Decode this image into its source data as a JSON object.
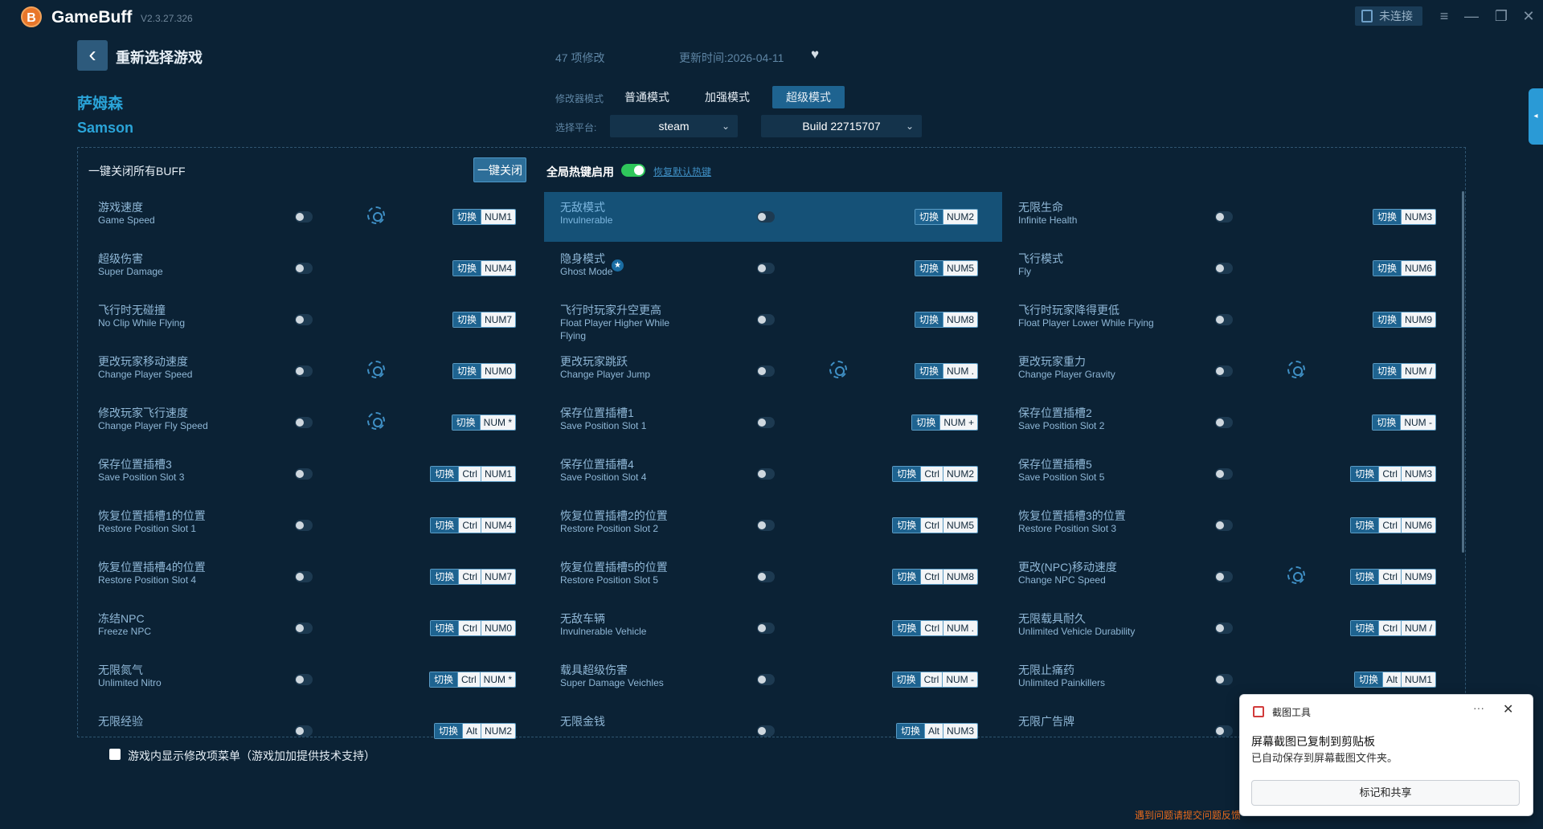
{
  "app": {
    "name": "GameBuff",
    "version": "V2.3.27.326",
    "logo_letter": "B",
    "status": "未连接"
  },
  "header": {
    "back_label": "重新选择游戏",
    "count_text": "47 项修改",
    "update_text": "更新时间:2026-04-11"
  },
  "game": {
    "name_cn": "萨姆森",
    "name_en": "Samson"
  },
  "modes": {
    "label": "修改器模式",
    "items": [
      "普通模式",
      "加强模式",
      "超级模式"
    ],
    "active": "超级模式"
  },
  "platform": {
    "label": "选择平台:",
    "selected": "steam",
    "build": "Build 22715707"
  },
  "toolbar": {
    "close_all_label": "一键关闭所有BUFF",
    "close_btn": "一键关闭",
    "hotkey_label": "全局热键启用",
    "hotkey_enabled": true,
    "restore_link": "恢复默认热键"
  },
  "switch_label": "切换",
  "cheats": [
    {
      "cn": "游戏速度",
      "en": "Game Speed",
      "keys": [
        "NUM1"
      ],
      "gear": true
    },
    {
      "cn": "无敌模式",
      "en": "Invulnerable",
      "keys": [
        "NUM2"
      ],
      "highlight": true
    },
    {
      "cn": "无限生命",
      "en": "Infinite Health",
      "keys": [
        "NUM3"
      ]
    },
    {
      "cn": "超级伤害",
      "en": "Super Damage",
      "keys": [
        "NUM4"
      ]
    },
    {
      "cn": "隐身模式",
      "en": "Ghost Mode",
      "keys": [
        "NUM5"
      ],
      "star": true
    },
    {
      "cn": "飞行模式",
      "en": "Fly",
      "keys": [
        "NUM6"
      ]
    },
    {
      "cn": "飞行时无碰撞",
      "en": "No Clip While Flying",
      "keys": [
        "NUM7"
      ]
    },
    {
      "cn": "飞行时玩家升空更高",
      "en": "Float Player Higher While Flying",
      "keys": [
        "NUM8"
      ]
    },
    {
      "cn": "飞行时玩家降得更低",
      "en": "Float Player Lower While Flying",
      "keys": [
        "NUM9"
      ]
    },
    {
      "cn": "更改玩家移动速度",
      "en": "Change Player Speed",
      "keys": [
        "NUM0"
      ],
      "gear": true
    },
    {
      "cn": "更改玩家跳跃",
      "en": "Change Player Jump",
      "keys": [
        "NUM ."
      ],
      "gear": true
    },
    {
      "cn": "更改玩家重力",
      "en": "Change Player Gravity",
      "keys": [
        "NUM /"
      ],
      "gear": true
    },
    {
      "cn": "修改玩家飞行速度",
      "en": "Change Player Fly Speed",
      "keys": [
        "NUM *"
      ],
      "gear": true
    },
    {
      "cn": "保存位置插槽1",
      "en": "Save Position Slot 1",
      "keys": [
        "NUM +"
      ]
    },
    {
      "cn": "保存位置插槽2",
      "en": "Save Position Slot 2",
      "keys": [
        "NUM -"
      ]
    },
    {
      "cn": "保存位置插槽3",
      "en": "Save Position Slot 3",
      "keys": [
        "Ctrl",
        "NUM1"
      ]
    },
    {
      "cn": "保存位置插槽4",
      "en": "Save Position Slot 4",
      "keys": [
        "Ctrl",
        "NUM2"
      ]
    },
    {
      "cn": "保存位置插槽5",
      "en": "Save Position Slot 5",
      "keys": [
        "Ctrl",
        "NUM3"
      ]
    },
    {
      "cn": "恢复位置插槽1的位置",
      "en": "Restore Position Slot 1",
      "keys": [
        "Ctrl",
        "NUM4"
      ]
    },
    {
      "cn": "恢复位置插槽2的位置",
      "en": "Restore Position Slot 2",
      "keys": [
        "Ctrl",
        "NUM5"
      ]
    },
    {
      "cn": "恢复位置插槽3的位置",
      "en": "Restore Position Slot 3",
      "keys": [
        "Ctrl",
        "NUM6"
      ]
    },
    {
      "cn": "恢复位置插槽4的位置",
      "en": "Restore Position Slot 4",
      "keys": [
        "Ctrl",
        "NUM7"
      ]
    },
    {
      "cn": "恢复位置插槽5的位置",
      "en": "Restore Position Slot 5",
      "keys": [
        "Ctrl",
        "NUM8"
      ]
    },
    {
      "cn": "更改(NPC)移动速度",
      "en": "Change NPC Speed",
      "keys": [
        "Ctrl",
        "NUM9"
      ],
      "gear": true
    },
    {
      "cn": "冻结NPC",
      "en": "Freeze NPC",
      "keys": [
        "Ctrl",
        "NUM0"
      ]
    },
    {
      "cn": "无敌车辆",
      "en": "Invulnerable Vehicle",
      "keys": [
        "Ctrl",
        "NUM ."
      ]
    },
    {
      "cn": "无限载具耐久",
      "en": "Unlimited Vehicle Durability",
      "keys": [
        "Ctrl",
        "NUM /"
      ]
    },
    {
      "cn": "无限氮气",
      "en": "Unlimited Nitro",
      "keys": [
        "Ctrl",
        "NUM *"
      ]
    },
    {
      "cn": "载具超级伤害",
      "en": "Super Damage Veichles",
      "keys": [
        "Ctrl",
        "NUM -"
      ]
    },
    {
      "cn": "无限止痛药",
      "en": "Unlimited Painkillers",
      "keys": [
        "Alt",
        "NUM1"
      ]
    },
    {
      "cn": "无限经验",
      "en": "",
      "keys": [
        "Alt",
        "NUM2"
      ]
    },
    {
      "cn": "无限金钱",
      "en": "",
      "keys": [
        "Alt",
        "NUM3"
      ]
    },
    {
      "cn": "无限广告牌",
      "en": "",
      "keys": []
    }
  ],
  "footer": {
    "overlay_label": "游戏内显示修改项菜单（游戏加加提供技术支持）",
    "feedback": "遇到问题请提交问题反馈"
  },
  "toast": {
    "app": "截图工具",
    "title": "屏幕截图已复制到剪贴板",
    "body": "已自动保存到屏幕截图文件夹。",
    "button": "标记和共享",
    "more": "···",
    "close": "✕"
  }
}
